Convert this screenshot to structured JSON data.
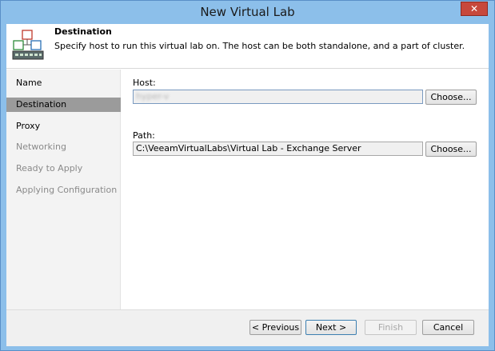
{
  "window": {
    "title": "New Virtual Lab",
    "close_glyph": "✕"
  },
  "header": {
    "title": "Destination",
    "description": "Specify host to run this virtual lab on. The host can be both standalone, and a part of cluster.",
    "icon": "virtual-lab-icon"
  },
  "steps": [
    {
      "label": "Name",
      "state": "enabled"
    },
    {
      "label": "Destination",
      "state": "active"
    },
    {
      "label": "Proxy",
      "state": "enabled"
    },
    {
      "label": "Networking",
      "state": "disabled"
    },
    {
      "label": "Ready to Apply",
      "state": "disabled"
    },
    {
      "label": "Applying Configuration",
      "state": "disabled"
    }
  ],
  "form": {
    "host_label": "Host:",
    "host_value": "hyper-v",
    "host_choose": "Choose...",
    "path_label": "Path:",
    "path_value": "C:\\VeeamVirtualLabs\\Virtual Lab - Exchange Server",
    "path_choose": "Choose..."
  },
  "footer": {
    "previous": "< Previous",
    "next": "Next >",
    "finish": "Finish",
    "cancel": "Cancel"
  }
}
